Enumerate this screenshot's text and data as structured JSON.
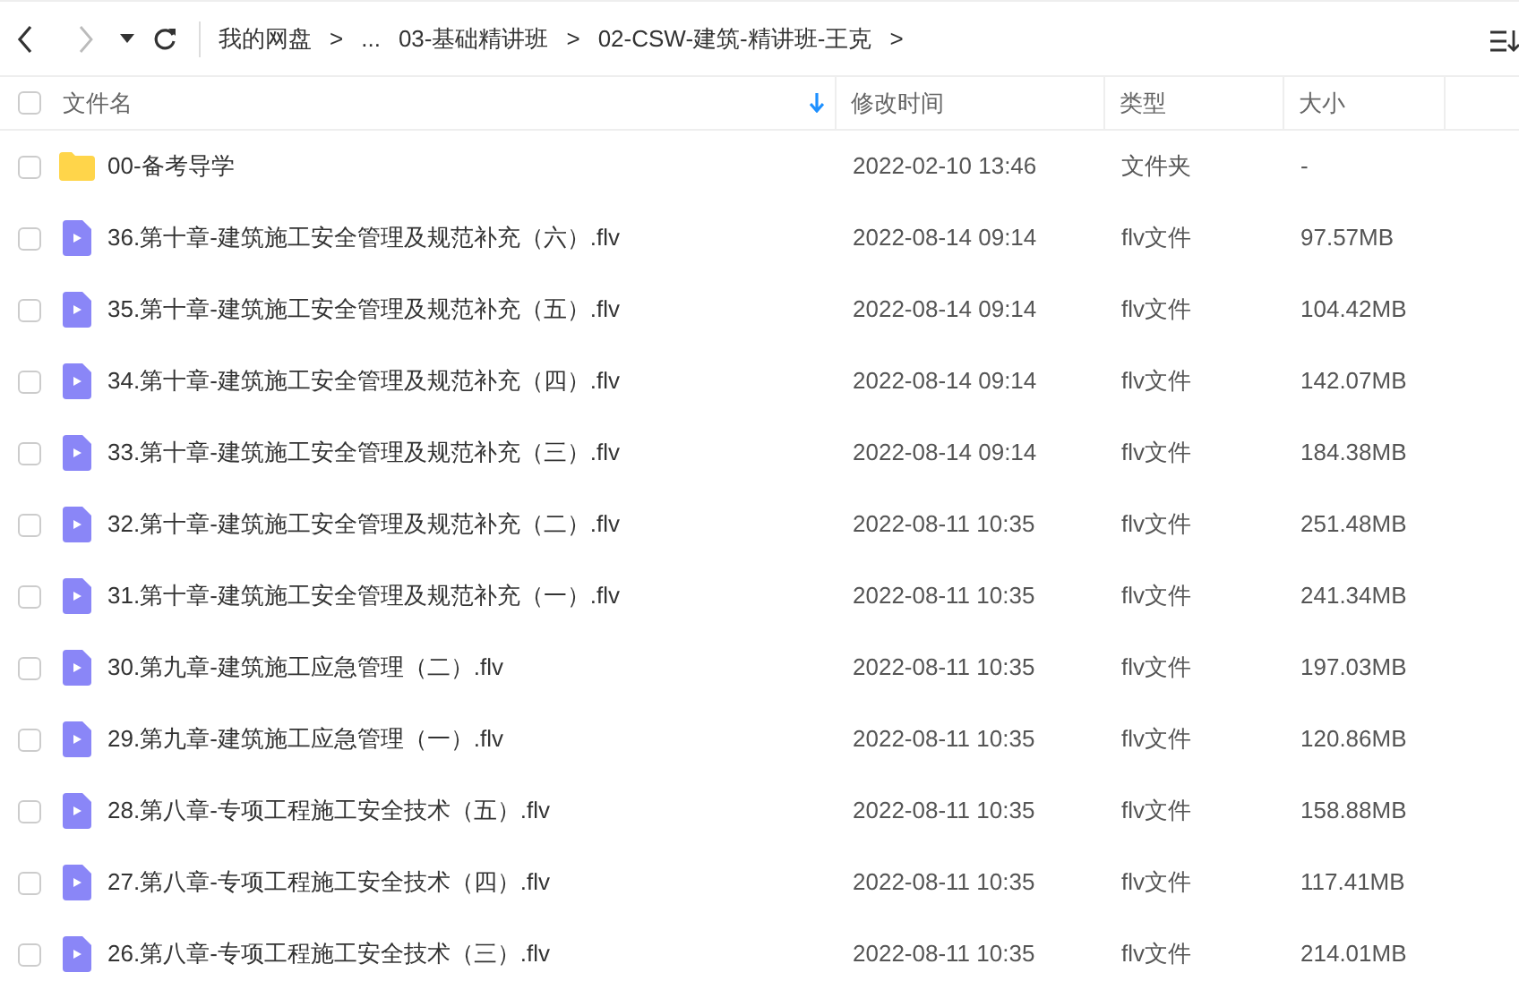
{
  "breadcrumb": [
    "我的网盘",
    ">",
    "...",
    "03-基础精讲班",
    ">",
    "02-CSW-建筑-精讲班-王克",
    ">"
  ],
  "select_all": {
    "checked": false
  },
  "columns": [
    "文件名",
    "修改时间",
    "类型",
    "大小"
  ],
  "rows": [
    {
      "kind": "folder",
      "checked": false,
      "name": "00-备考导学",
      "modified": "2022-02-10 13:46",
      "type": "文件夹",
      "size": "-"
    },
    {
      "kind": "video",
      "checked": false,
      "name": "36.第十章-建筑施工安全管理及规范补充（六）.flv",
      "modified": "2022-08-14 09:14",
      "type": "flv文件",
      "size": "97.57MB"
    },
    {
      "kind": "video",
      "checked": false,
      "name": "35.第十章-建筑施工安全管理及规范补充（五）.flv",
      "modified": "2022-08-14 09:14",
      "type": "flv文件",
      "size": "104.42MB"
    },
    {
      "kind": "video",
      "checked": false,
      "name": "34.第十章-建筑施工安全管理及规范补充（四）.flv",
      "modified": "2022-08-14 09:14",
      "type": "flv文件",
      "size": "142.07MB"
    },
    {
      "kind": "video",
      "checked": false,
      "name": "33.第十章-建筑施工安全管理及规范补充（三）.flv",
      "modified": "2022-08-14 09:14",
      "type": "flv文件",
      "size": "184.38MB"
    },
    {
      "kind": "video",
      "checked": false,
      "name": "32.第十章-建筑施工安全管理及规范补充（二）.flv",
      "modified": "2022-08-11 10:35",
      "type": "flv文件",
      "size": "251.48MB"
    },
    {
      "kind": "video",
      "checked": false,
      "name": "31.第十章-建筑施工安全管理及规范补充（一）.flv",
      "modified": "2022-08-11 10:35",
      "type": "flv文件",
      "size": "241.34MB"
    },
    {
      "kind": "video",
      "checked": false,
      "name": "30.第九章-建筑施工应急管理（二）.flv",
      "modified": "2022-08-11 10:35",
      "type": "flv文件",
      "size": "197.03MB"
    },
    {
      "kind": "video",
      "checked": false,
      "name": "29.第九章-建筑施工应急管理（一）.flv",
      "modified": "2022-08-11 10:35",
      "type": "flv文件",
      "size": "120.86MB"
    },
    {
      "kind": "video",
      "checked": false,
      "name": "28.第八章-专项工程施工安全技术（五）.flv",
      "modified": "2022-08-11 10:35",
      "type": "flv文件",
      "size": "158.88MB"
    },
    {
      "kind": "video",
      "checked": false,
      "name": "27.第八章-专项工程施工安全技术（四）.flv",
      "modified": "2022-08-11 10:35",
      "type": "flv文件",
      "size": "117.41MB"
    },
    {
      "kind": "video",
      "checked": false,
      "name": "26.第八章-专项工程施工安全技术（三）.flv",
      "modified": "2022-08-11 10:35",
      "type": "flv文件",
      "size": "214.01MB"
    }
  ]
}
